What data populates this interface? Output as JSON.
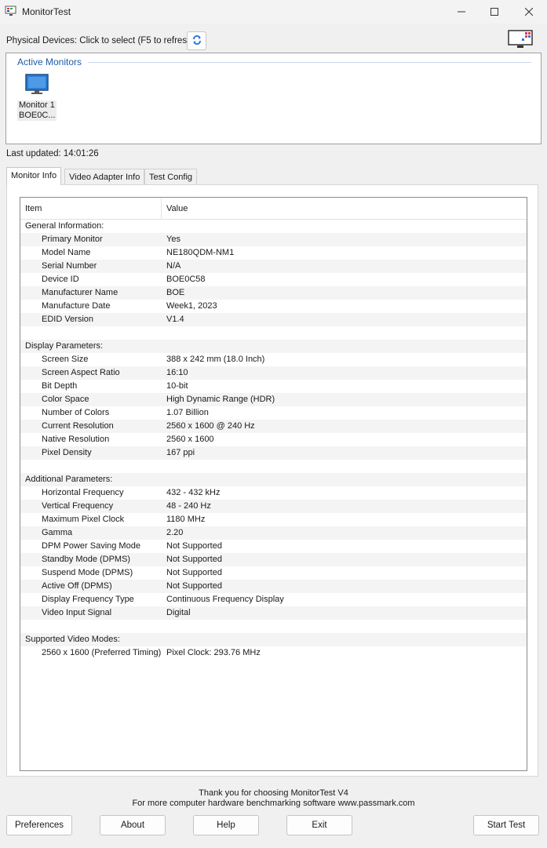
{
  "window": {
    "title": "MonitorTest"
  },
  "devices": {
    "label": "Physical Devices: Click to select (F5 to refresh)",
    "active_header": "Active Monitors",
    "monitors": [
      {
        "name": "Monitor 1",
        "code": "BOE0C..."
      }
    ],
    "last_updated": "Last updated:  14:01:26"
  },
  "tabs": [
    {
      "label": "Monitor Info",
      "active": true
    },
    {
      "label": "Video Adapter Info",
      "active": false
    },
    {
      "label": "Test Config",
      "active": false
    }
  ],
  "grid": {
    "col_item": "Item",
    "col_value": "Value",
    "rows": [
      {
        "item": "General Information:",
        "value": "",
        "section": true
      },
      {
        "item": "Primary Monitor",
        "value": "Yes"
      },
      {
        "item": "Model Name",
        "value": "NE180QDM-NM1"
      },
      {
        "item": "Serial Number",
        "value": "N/A"
      },
      {
        "item": "Device ID",
        "value": "BOE0C58"
      },
      {
        "item": "Manufacturer Name",
        "value": "BOE"
      },
      {
        "item": "Manufacture Date",
        "value": "Week1, 2023"
      },
      {
        "item": "EDID Version",
        "value": "V1.4"
      },
      {
        "item": "",
        "value": "",
        "blank": true
      },
      {
        "item": "Display Parameters:",
        "value": "",
        "section": true
      },
      {
        "item": "Screen Size",
        "value": "388 x 242 mm (18.0 Inch)"
      },
      {
        "item": "Screen Aspect Ratio",
        "value": "16:10"
      },
      {
        "item": "Bit Depth",
        "value": "10-bit"
      },
      {
        "item": "Color Space",
        "value": "High Dynamic Range (HDR)"
      },
      {
        "item": "Number of Colors",
        "value": "1.07 Billion"
      },
      {
        "item": "Current Resolution",
        "value": "2560 x 1600 @ 240 Hz"
      },
      {
        "item": "Native Resolution",
        "value": "2560 x 1600"
      },
      {
        "item": "Pixel Density",
        "value": "167 ppi"
      },
      {
        "item": "",
        "value": "",
        "blank": true
      },
      {
        "item": "Additional Parameters:",
        "value": "",
        "section": true
      },
      {
        "item": "Horizontal Frequency",
        "value": "432 - 432 kHz"
      },
      {
        "item": "Vertical Frequency",
        "value": "48 - 240 Hz"
      },
      {
        "item": "Maximum Pixel Clock",
        "value": "1180 MHz"
      },
      {
        "item": "Gamma",
        "value": "2.20"
      },
      {
        "item": "DPM Power Saving Mode",
        "value": "Not Supported"
      },
      {
        "item": "Standby Mode (DPMS)",
        "value": "Not Supported"
      },
      {
        "item": "Suspend Mode (DPMS)",
        "value": "Not Supported"
      },
      {
        "item": "Active Off (DPMS)",
        "value": "Not Supported"
      },
      {
        "item": "Display Frequency Type",
        "value": "Continuous Frequency Display"
      },
      {
        "item": "Video Input Signal",
        "value": "Digital"
      },
      {
        "item": "",
        "value": "",
        "blank": true
      },
      {
        "item": "Supported Video Modes:",
        "value": "",
        "section": true
      },
      {
        "item": "2560 x 1600 (Preferred Timing)",
        "value": "Pixel Clock: 293.76 MHz"
      }
    ]
  },
  "footer": {
    "thanks_line1": "Thank you for choosing MonitorTest V4",
    "thanks_line2": "For more computer hardware benchmarking software www.passmark.com",
    "buttons": {
      "preferences": "Preferences",
      "about": "About",
      "help": "Help",
      "exit": "Exit",
      "start_test": "Start Test"
    }
  },
  "icons": {
    "app": "monitortest-app-icon",
    "refresh": "refresh-icon",
    "logo": "passmark-monitor-logo-icon",
    "monitor": "monitor-icon"
  },
  "colors": {
    "accent": "#1f5ca8",
    "monitor_blue": "#2b7cd3"
  }
}
